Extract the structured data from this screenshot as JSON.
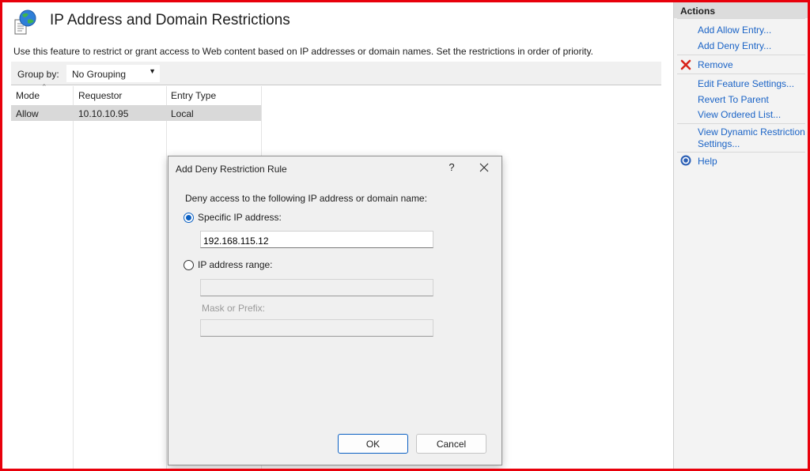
{
  "main": {
    "title": "IP Address and Domain Restrictions",
    "description": "Use this feature to restrict or grant access to Web content based on IP addresses or domain names. Set the restrictions in order of priority.",
    "group_by_label": "Group by:",
    "group_by_value": "No Grouping",
    "columns": [
      "Mode",
      "Requestor",
      "Entry Type"
    ],
    "rows": [
      {
        "mode": "Allow",
        "requestor": "10.10.10.95",
        "entry_type": "Local"
      }
    ]
  },
  "actions": {
    "header": "Actions",
    "items": [
      {
        "label": "Add Allow Entry...",
        "icon": "none"
      },
      {
        "label": "Add Deny Entry...",
        "icon": "none"
      },
      {
        "label": "Remove",
        "icon": "remove-x-icon"
      },
      {
        "label": "Edit Feature Settings...",
        "icon": "none"
      },
      {
        "label": "Revert To Parent",
        "icon": "none"
      },
      {
        "label": "View Ordered List...",
        "icon": "none"
      },
      {
        "label": "View Dynamic Restriction Settings...",
        "icon": "none"
      },
      {
        "label": "Help",
        "icon": "help-icon"
      }
    ]
  },
  "dialog": {
    "title": "Add Deny Restriction Rule",
    "help_glyph": "?",
    "prompt": "Deny access to the following IP address or domain name:",
    "specific_ip_label": "Specific IP address:",
    "specific_ip_value": "192.168.115.12",
    "ip_range_label": "IP address range:",
    "ip_range_value": "",
    "mask_label": "Mask or Prefix:",
    "mask_value": "",
    "selected_option": "specific",
    "ok_label": "OK",
    "cancel_label": "Cancel"
  },
  "colors": {
    "frame": "#e8000b",
    "link": "#1a63c6",
    "accent": "#0a5fc2",
    "selected_row": "#d9d9d9"
  }
}
